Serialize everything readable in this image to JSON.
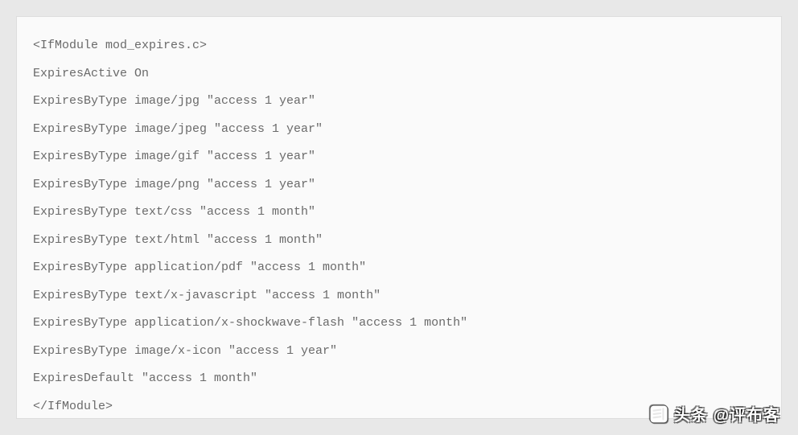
{
  "code": {
    "lines": [
      "<IfModule mod_expires.c>",
      "ExpiresActive On",
      "ExpiresByType image/jpg \"access 1 year\"",
      "ExpiresByType image/jpeg \"access 1 year\"",
      "ExpiresByType image/gif \"access 1 year\"",
      "ExpiresByType image/png \"access 1 year\"",
      "ExpiresByType text/css \"access 1 month\"",
      "ExpiresByType text/html \"access 1 month\"",
      "ExpiresByType application/pdf \"access 1 month\"",
      "ExpiresByType text/x-javascript \"access 1 month\"",
      "ExpiresByType application/x-shockwave-flash \"access 1 month\"",
      "ExpiresByType image/x-icon \"access 1 year\"",
      "ExpiresDefault \"access 1 month\"",
      "</IfModule>"
    ]
  },
  "watermark": {
    "text": "头条 @评布客"
  }
}
